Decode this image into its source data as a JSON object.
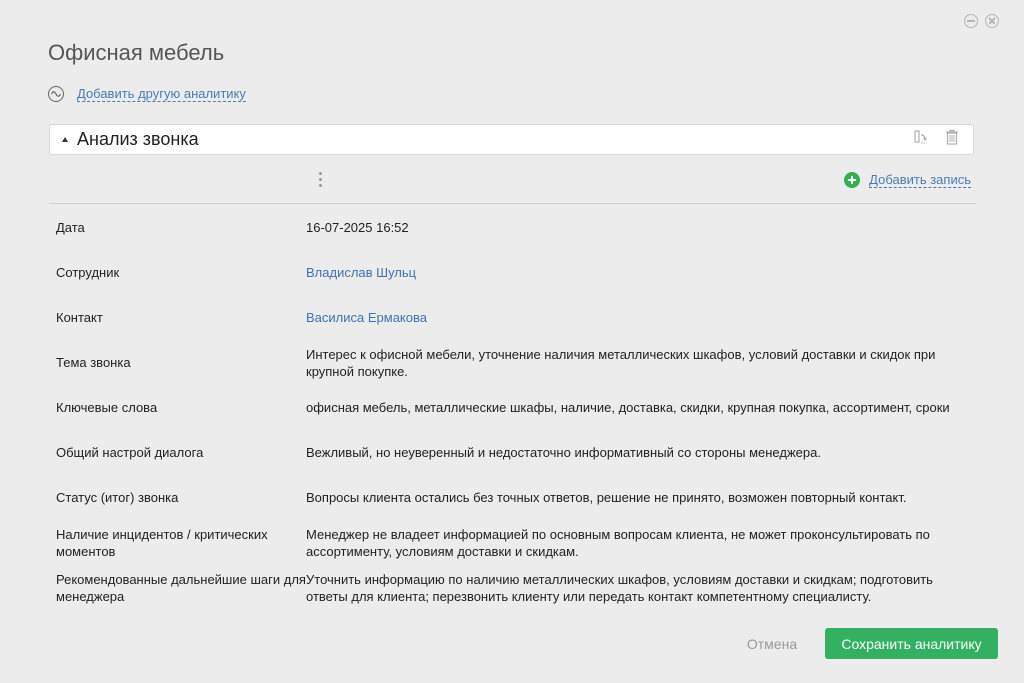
{
  "window": {
    "minimize_icon": "minimize-circle-icon",
    "close_icon": "close-circle-icon"
  },
  "page": {
    "title": "Офисная мебель"
  },
  "add_analytics": {
    "label": "Добавить другую аналитику",
    "icon": "wave-icon"
  },
  "section": {
    "title": "Анализ звонка",
    "icons": [
      "export-icon",
      "trash-icon"
    ]
  },
  "toolbar": {
    "add_record_label": "Добавить запись"
  },
  "fields": [
    {
      "label": "Дата",
      "value": "16-07-2025 16:52",
      "is_link": false
    },
    {
      "label": "Сотрудник",
      "value": "Владислав Шульц",
      "is_link": true
    },
    {
      "label": "Контакт",
      "value": "Василиса Ермакова",
      "is_link": true
    },
    {
      "label": "Тема звонка",
      "value": "Интерес к офисной мебели, уточнение наличия металлических шкафов, условий доставки и скидок при крупной покупке.",
      "is_link": false
    },
    {
      "label": "Ключевые слова",
      "value": "офисная мебель, металлические шкафы, наличие, доставка, скидки, крупная покупка, ассортимент, сроки",
      "is_link": false
    },
    {
      "label": "Общий настрой диалога",
      "value": "Вежливый, но неуверенный и недостаточно информативный со стороны менеджера.",
      "is_link": false
    },
    {
      "label": "Статус (итог) звонка",
      "value": "Вопросы клиента остались без точных ответов, решение не принято, возможен повторный контакт.",
      "is_link": false
    },
    {
      "label": "Наличие инцидентов / критических моментов",
      "value": "Менеджер не владеет информацией по основным вопросам клиента, не может проконсультировать по ассортименту, условиям доставки и скидкам.",
      "is_link": false
    },
    {
      "label": "Рекомендованные дальнейшие шаги для менеджера",
      "value": "Уточнить информацию по наличию металлических шкафов, условиям доставки и скидкам; подготовить ответы для клиента; перезвонить клиенту или передать контакт компетентному специалисту.",
      "is_link": false
    }
  ],
  "footer": {
    "cancel_label": "Отмена",
    "save_label": "Сохранить аналитику"
  },
  "colors": {
    "accent_green": "#33b062",
    "link_blue": "#3f72b3",
    "background": "#ececec"
  }
}
